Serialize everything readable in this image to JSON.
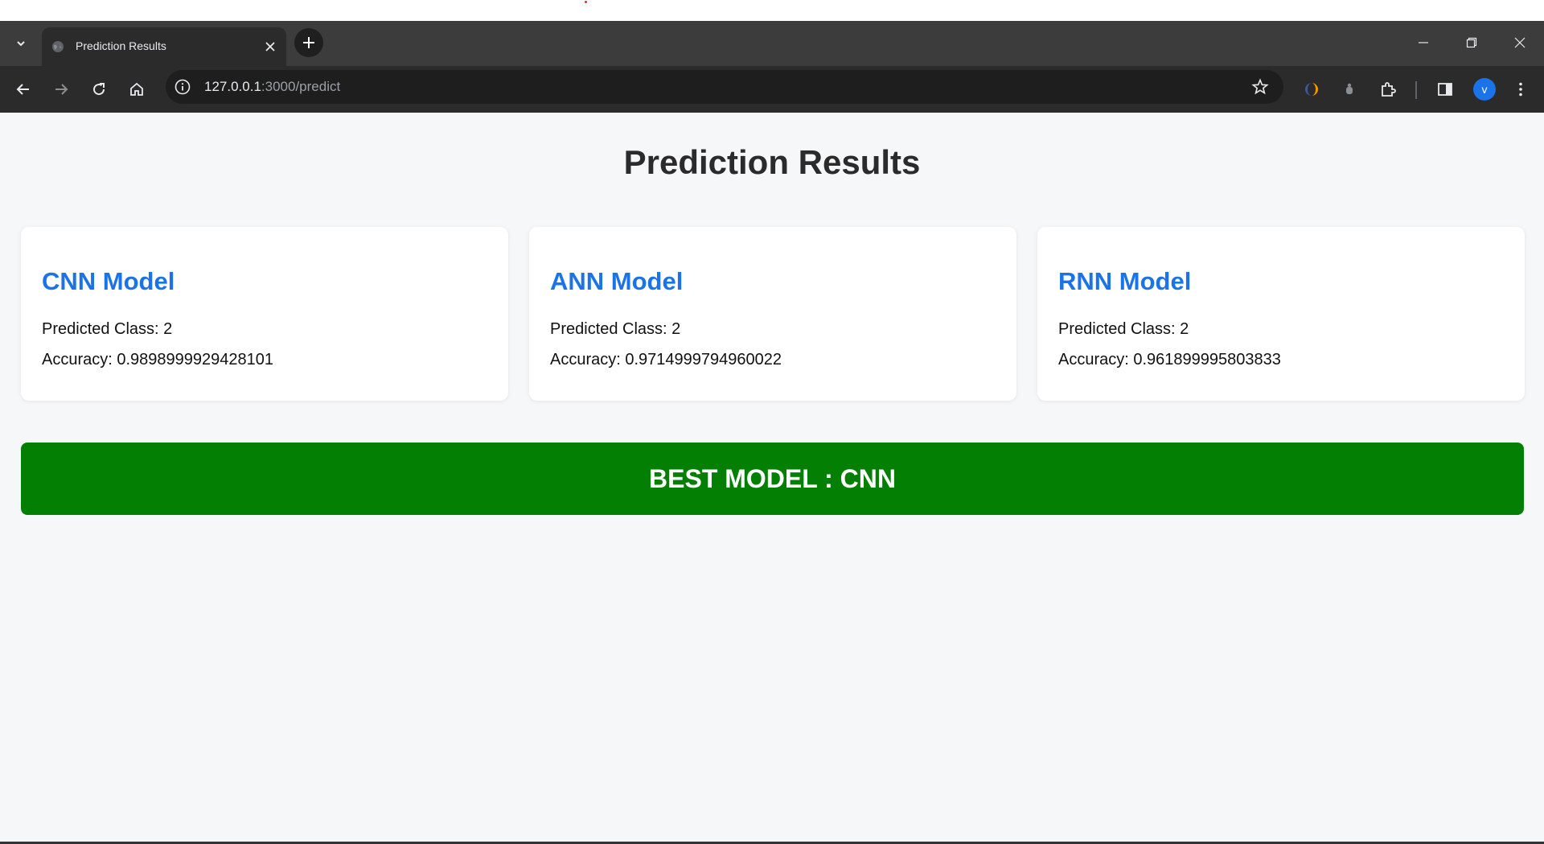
{
  "tab": {
    "title": "Prediction Results",
    "favicon": "globe-icon"
  },
  "address_bar": {
    "host": "127.0.0.1",
    "path": ":3000/predict"
  },
  "profile": {
    "initial": "v",
    "color": "#1a73e8"
  },
  "page": {
    "title": "Prediction Results",
    "cards": [
      {
        "title": "CNN Model",
        "class_label": "Predicted Class: 2",
        "accuracy_label": "Accuracy: 0.9898999929428101"
      },
      {
        "title": "ANN Model",
        "class_label": "Predicted Class: 2",
        "accuracy_label": "Accuracy: 0.9714999794960022"
      },
      {
        "title": "RNN Model",
        "class_label": "Predicted Class: 2",
        "accuracy_label": "Accuracy: 0.961899995803833"
      }
    ],
    "best_model": "BEST MODEL : CNN"
  },
  "colors": {
    "accent": "#1a73e8",
    "best_banner": "#038003",
    "page_background": "#f6f7f9",
    "browser_chrome": "#2b2b2b"
  }
}
